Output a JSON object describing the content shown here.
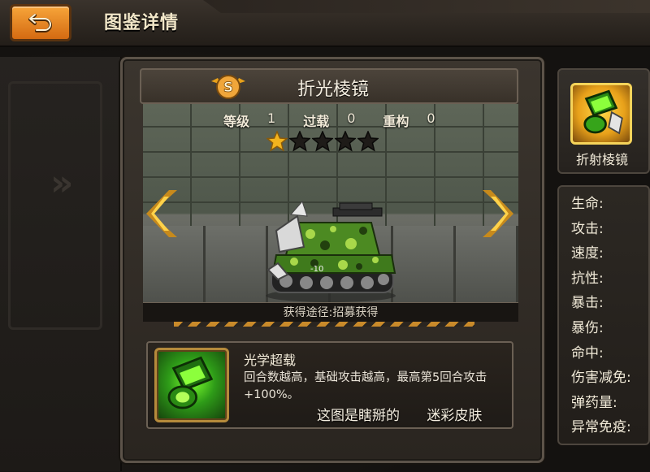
{
  "header": {
    "title": "图鉴详情",
    "back_icon": "return-arrow-icon"
  },
  "item": {
    "name": "折光棱镜",
    "rank_badge": "S",
    "stats": [
      {
        "label": "等级",
        "value": "1"
      },
      {
        "label": "过载",
        "value": "0"
      },
      {
        "label": "重构",
        "value": "0"
      }
    ],
    "stars_filled": 1,
    "stars_total": 5,
    "source": "获得途径:招募获得",
    "tank_plate": "-10"
  },
  "skill": {
    "title": "光学超载",
    "description": "回合数越高，基础攻击越高，最高第5回合攻击+100%。"
  },
  "overlay_note": {
    "text": "这图是瞎掰的",
    "skin": "迷彩皮肤"
  },
  "sidebar": {
    "item_label": "折射棱镜",
    "attributes": [
      "生命:",
      "攻击:",
      "速度:",
      "抗性:",
      "暴击:",
      "暴伤:",
      "命中:",
      "伤害减免:",
      "弹药量:",
      "异常免疫:"
    ]
  },
  "colors": {
    "accent": "#f0a63a",
    "skill_green": "#5fd82a",
    "panel_border": "#6b6054",
    "text": "#f1ead8"
  }
}
